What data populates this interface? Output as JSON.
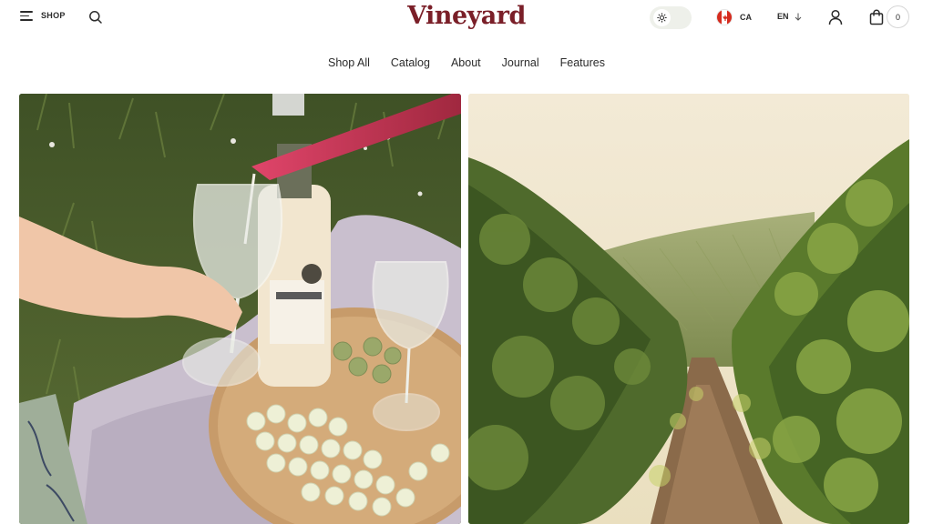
{
  "header": {
    "menu_label": "SHOP",
    "logo": "Vineyard",
    "country_code": "CA",
    "language": "EN",
    "cart_count": "0"
  },
  "nav": {
    "items": [
      "Shop All",
      "Catalog",
      "About",
      "Journal",
      "Features"
    ]
  },
  "hero": {
    "left_image": "wine pouring picnic photo",
    "right_image": "vineyard rows photo"
  },
  "icons": {
    "menu": "hamburger-icon",
    "search": "search-icon",
    "theme": "sun-icon",
    "flag": "canada-flag-icon",
    "language_arrow": "arrow-down-icon",
    "account": "user-icon",
    "cart": "bag-icon"
  },
  "colors": {
    "brand": "#7a1f28",
    "text": "#2b2b2b",
    "toggle_bg": "#eef0ea"
  }
}
